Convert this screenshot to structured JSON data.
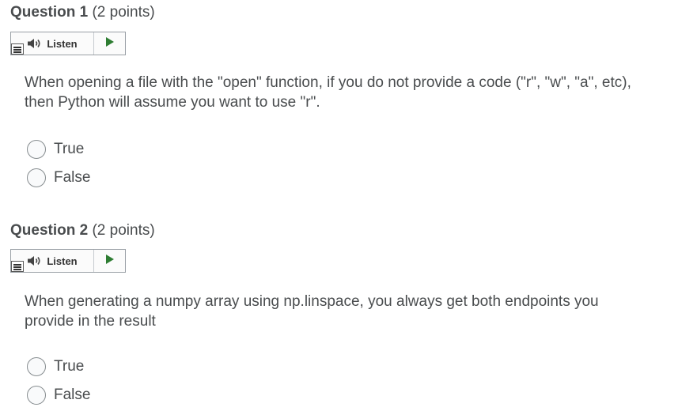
{
  "questions": [
    {
      "name": "Question 1",
      "points": "(2 points)",
      "listen_label": "Listen",
      "text": "When opening a file with the \"open\" function, if you do not provide a code (\"r\", \"w\", \"a\", etc), then Python will assume you want to use \"r\".",
      "options": [
        "True",
        "False"
      ]
    },
    {
      "name": "Question 2",
      "points": "(2 points)",
      "listen_label": "Listen",
      "text": "When generating a numpy array using np.linspace, you always get both endpoints you provide in the result",
      "options": [
        "True",
        "False"
      ]
    }
  ],
  "colors": {
    "text": "#494c4e",
    "play_green": "#2e7d32",
    "radio_border": "#868c8f"
  },
  "icons": {
    "menu": "menu-icon",
    "speaker": "speaker-icon",
    "play": "play-icon"
  }
}
